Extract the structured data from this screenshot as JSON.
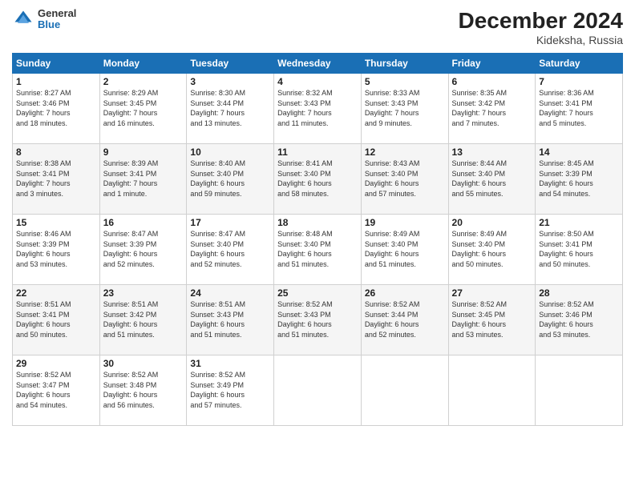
{
  "header": {
    "logo_general": "General",
    "logo_blue": "Blue",
    "title": "December 2024",
    "subtitle": "Kideksha, Russia"
  },
  "days_of_week": [
    "Sunday",
    "Monday",
    "Tuesday",
    "Wednesday",
    "Thursday",
    "Friday",
    "Saturday"
  ],
  "weeks": [
    [
      {
        "day": "1",
        "info": "Sunrise: 8:27 AM\nSunset: 3:46 PM\nDaylight: 7 hours\nand 18 minutes."
      },
      {
        "day": "2",
        "info": "Sunrise: 8:29 AM\nSunset: 3:45 PM\nDaylight: 7 hours\nand 16 minutes."
      },
      {
        "day": "3",
        "info": "Sunrise: 8:30 AM\nSunset: 3:44 PM\nDaylight: 7 hours\nand 13 minutes."
      },
      {
        "day": "4",
        "info": "Sunrise: 8:32 AM\nSunset: 3:43 PM\nDaylight: 7 hours\nand 11 minutes."
      },
      {
        "day": "5",
        "info": "Sunrise: 8:33 AM\nSunset: 3:43 PM\nDaylight: 7 hours\nand 9 minutes."
      },
      {
        "day": "6",
        "info": "Sunrise: 8:35 AM\nSunset: 3:42 PM\nDaylight: 7 hours\nand 7 minutes."
      },
      {
        "day": "7",
        "info": "Sunrise: 8:36 AM\nSunset: 3:41 PM\nDaylight: 7 hours\nand 5 minutes."
      }
    ],
    [
      {
        "day": "8",
        "info": "Sunrise: 8:38 AM\nSunset: 3:41 PM\nDaylight: 7 hours\nand 3 minutes."
      },
      {
        "day": "9",
        "info": "Sunrise: 8:39 AM\nSunset: 3:41 PM\nDaylight: 7 hours\nand 1 minute."
      },
      {
        "day": "10",
        "info": "Sunrise: 8:40 AM\nSunset: 3:40 PM\nDaylight: 6 hours\nand 59 minutes."
      },
      {
        "day": "11",
        "info": "Sunrise: 8:41 AM\nSunset: 3:40 PM\nDaylight: 6 hours\nand 58 minutes."
      },
      {
        "day": "12",
        "info": "Sunrise: 8:43 AM\nSunset: 3:40 PM\nDaylight: 6 hours\nand 57 minutes."
      },
      {
        "day": "13",
        "info": "Sunrise: 8:44 AM\nSunset: 3:40 PM\nDaylight: 6 hours\nand 55 minutes."
      },
      {
        "day": "14",
        "info": "Sunrise: 8:45 AM\nSunset: 3:39 PM\nDaylight: 6 hours\nand 54 minutes."
      }
    ],
    [
      {
        "day": "15",
        "info": "Sunrise: 8:46 AM\nSunset: 3:39 PM\nDaylight: 6 hours\nand 53 minutes."
      },
      {
        "day": "16",
        "info": "Sunrise: 8:47 AM\nSunset: 3:39 PM\nDaylight: 6 hours\nand 52 minutes."
      },
      {
        "day": "17",
        "info": "Sunrise: 8:47 AM\nSunset: 3:40 PM\nDaylight: 6 hours\nand 52 minutes."
      },
      {
        "day": "18",
        "info": "Sunrise: 8:48 AM\nSunset: 3:40 PM\nDaylight: 6 hours\nand 51 minutes."
      },
      {
        "day": "19",
        "info": "Sunrise: 8:49 AM\nSunset: 3:40 PM\nDaylight: 6 hours\nand 51 minutes."
      },
      {
        "day": "20",
        "info": "Sunrise: 8:49 AM\nSunset: 3:40 PM\nDaylight: 6 hours\nand 50 minutes."
      },
      {
        "day": "21",
        "info": "Sunrise: 8:50 AM\nSunset: 3:41 PM\nDaylight: 6 hours\nand 50 minutes."
      }
    ],
    [
      {
        "day": "22",
        "info": "Sunrise: 8:51 AM\nSunset: 3:41 PM\nDaylight: 6 hours\nand 50 minutes."
      },
      {
        "day": "23",
        "info": "Sunrise: 8:51 AM\nSunset: 3:42 PM\nDaylight: 6 hours\nand 51 minutes."
      },
      {
        "day": "24",
        "info": "Sunrise: 8:51 AM\nSunset: 3:43 PM\nDaylight: 6 hours\nand 51 minutes."
      },
      {
        "day": "25",
        "info": "Sunrise: 8:52 AM\nSunset: 3:43 PM\nDaylight: 6 hours\nand 51 minutes."
      },
      {
        "day": "26",
        "info": "Sunrise: 8:52 AM\nSunset: 3:44 PM\nDaylight: 6 hours\nand 52 minutes."
      },
      {
        "day": "27",
        "info": "Sunrise: 8:52 AM\nSunset: 3:45 PM\nDaylight: 6 hours\nand 53 minutes."
      },
      {
        "day": "28",
        "info": "Sunrise: 8:52 AM\nSunset: 3:46 PM\nDaylight: 6 hours\nand 53 minutes."
      }
    ],
    [
      {
        "day": "29",
        "info": "Sunrise: 8:52 AM\nSunset: 3:47 PM\nDaylight: 6 hours\nand 54 minutes."
      },
      {
        "day": "30",
        "info": "Sunrise: 8:52 AM\nSunset: 3:48 PM\nDaylight: 6 hours\nand 56 minutes."
      },
      {
        "day": "31",
        "info": "Sunrise: 8:52 AM\nSunset: 3:49 PM\nDaylight: 6 hours\nand 57 minutes."
      },
      null,
      null,
      null,
      null
    ]
  ]
}
